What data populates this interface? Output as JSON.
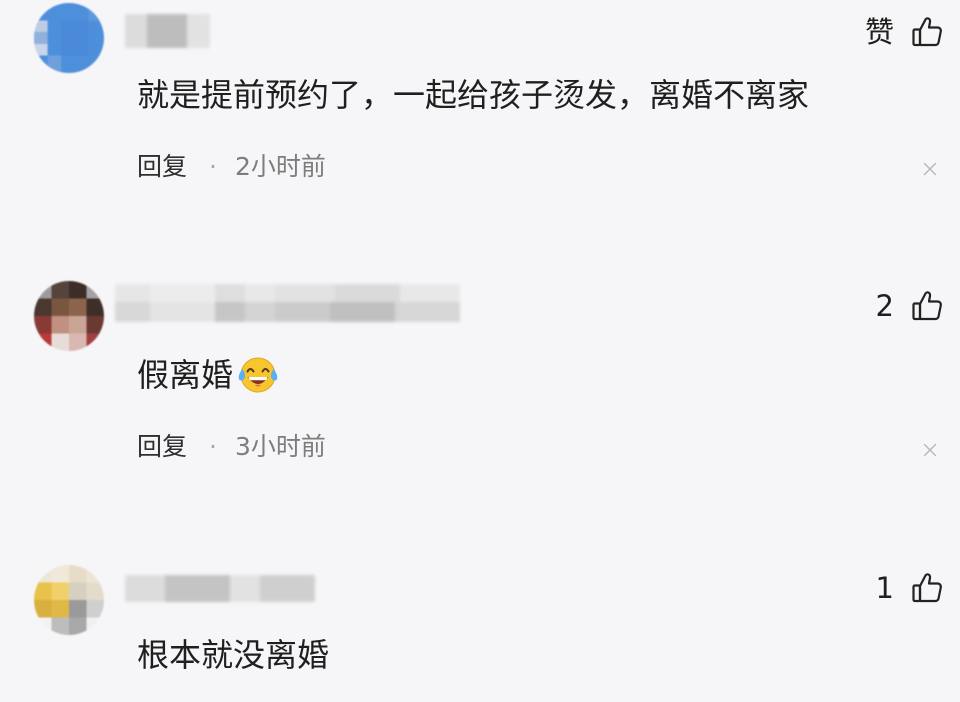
{
  "theme": {
    "background": "#f6f6f8",
    "text": "#1f1f1f",
    "secondary_text": "#7d7d7d",
    "close_icon_color": "#b7b7b7",
    "avatar_accent_1": "#4e8fdb"
  },
  "comments": [
    {
      "like_label": "赞",
      "like_icon": "thumbs-up-icon",
      "text": "就是提前预约了，一起给孩子烫发，离婚不离家",
      "reply_label": "回复",
      "separator": "·",
      "time": "2小时前",
      "close_icon": "close-icon"
    },
    {
      "like_label": "2",
      "like_icon": "thumbs-up-icon",
      "text": "假离婚",
      "emoji_icon": "face-with-tears-of-joy-icon",
      "reply_label": "回复",
      "separator": "·",
      "time": "3小时前",
      "close_icon": "close-icon"
    },
    {
      "like_label": "1",
      "like_icon": "thumbs-up-icon",
      "text": "根本就没离婚"
    }
  ]
}
